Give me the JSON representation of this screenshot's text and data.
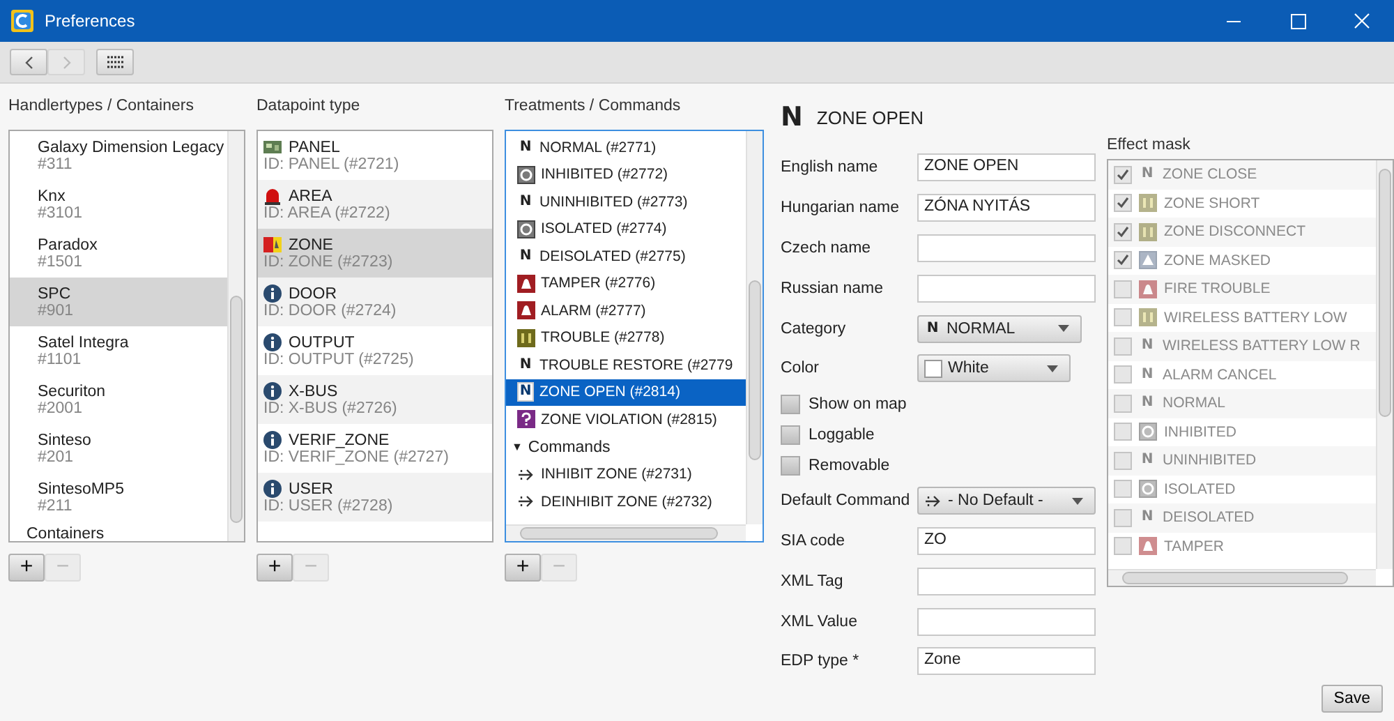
{
  "window": {
    "title": "Preferences"
  },
  "toolbar": {
    "back": {
      "disabled": false
    },
    "forward": {
      "disabled": true
    }
  },
  "handlers": {
    "heading": "Handlertypes / Containers",
    "items": [
      {
        "kind": "item",
        "name": "Galaxy Dimension Legacy",
        "id": "#311",
        "selected": false
      },
      {
        "kind": "item",
        "name": "Knx",
        "id": "#3101",
        "selected": false
      },
      {
        "kind": "item",
        "name": "Paradox",
        "id": "#1501",
        "selected": false
      },
      {
        "kind": "item",
        "name": "SPC",
        "id": "#901",
        "selected": true
      },
      {
        "kind": "item",
        "name": "Satel Integra",
        "id": "#1101",
        "selected": false
      },
      {
        "kind": "item",
        "name": "Securiton",
        "id": "#2001",
        "selected": false
      },
      {
        "kind": "item",
        "name": "Sinteso",
        "id": "#201",
        "selected": false
      },
      {
        "kind": "item",
        "name": "SintesoMP5",
        "id": "#211",
        "selected": false
      },
      {
        "kind": "group",
        "name": "Containers"
      }
    ],
    "add": {
      "label": "+",
      "disabled": false
    },
    "remove": {
      "label": "−",
      "disabled": true
    }
  },
  "datapoints": {
    "heading": "Datapoint type",
    "items": [
      {
        "kind": "panel",
        "name": "PANEL",
        "id": "ID: PANEL (#2721)",
        "selected": false
      },
      {
        "kind": "beacon",
        "name": "AREA",
        "id": "ID: AREA (#2722)",
        "selected": false
      },
      {
        "kind": "zone",
        "name": "ZONE",
        "id": "ID: ZONE (#2723)",
        "selected": true
      },
      {
        "kind": "info",
        "name": "DOOR",
        "id": "ID: DOOR (#2724)",
        "selected": false
      },
      {
        "kind": "info",
        "name": "OUTPUT",
        "id": "ID: OUTPUT (#2725)",
        "selected": false
      },
      {
        "kind": "info",
        "name": "X-BUS",
        "id": "ID: X-BUS (#2726)",
        "selected": false
      },
      {
        "kind": "info",
        "name": "VERIF_ZONE",
        "id": "ID: VERIF_ZONE (#2727)",
        "selected": false
      },
      {
        "kind": "info",
        "name": "USER",
        "id": "ID: USER (#2728)",
        "selected": false
      }
    ],
    "add": {
      "label": "+",
      "disabled": false
    },
    "remove": {
      "label": "−",
      "disabled": true
    }
  },
  "treatments": {
    "heading": "Treatments / Commands",
    "items": [
      {
        "kind": "letter",
        "glyph": "N",
        "label": "NORMAL (#2771)",
        "selected": false
      },
      {
        "kind": "inhibit",
        "label": "INHIBITED (#2772)",
        "selected": false
      },
      {
        "kind": "letter",
        "glyph": "N",
        "label": "UNINHIBITED (#2773)",
        "selected": false
      },
      {
        "kind": "inhibit",
        "label": "ISOLATED (#2774)",
        "selected": false
      },
      {
        "kind": "letter",
        "glyph": "N",
        "label": "DEISOLATED (#2775)",
        "selected": false
      },
      {
        "kind": "bell",
        "label": "TAMPER (#2776)",
        "selected": false
      },
      {
        "kind": "bell",
        "label": "ALARM (#2777)",
        "selected": false
      },
      {
        "kind": "trouble",
        "label": "TROUBLE (#2778)",
        "selected": false
      },
      {
        "kind": "letter",
        "glyph": "N",
        "label": "TROUBLE RESTORE (#2779",
        "selected": false
      },
      {
        "kind": "letter",
        "glyph": "N",
        "label": "ZONE OPEN (#2814)",
        "selected": true
      },
      {
        "kind": "question",
        "label": "ZONE VIOLATION (#2815)",
        "selected": false
      }
    ],
    "groups": [
      {
        "toggle": "▼",
        "label": "Commands",
        "expanded": true,
        "children": [
          {
            "kind": "command",
            "label": "INHIBIT ZONE (#2731)",
            "selected": false
          },
          {
            "kind": "command",
            "label": "DEINHIBIT ZONE (#2732)",
            "selected": false
          }
        ]
      }
    ],
    "add": {
      "label": "+",
      "disabled": false
    },
    "remove": {
      "label": "−",
      "disabled": true
    }
  },
  "detail": {
    "glyph": "N",
    "title": "ZONE OPEN",
    "fields": [
      {
        "kind": "text",
        "label": "English name",
        "value": "ZONE OPEN"
      },
      {
        "kind": "text",
        "label": "Hungarian name",
        "value": "ZÓNA NYITÁS"
      },
      {
        "kind": "text",
        "label": "Czech name"
      },
      {
        "kind": "text",
        "label": "Russian name"
      },
      {
        "kind": "select",
        "label": "Category",
        "glyph": "N",
        "value": "NORMAL"
      },
      {
        "kind": "select",
        "label": "Color",
        "color": "#ffffff",
        "value": "White"
      },
      {
        "kind": "checkbox",
        "label": "Show on map",
        "checked": false
      },
      {
        "kind": "checkbox",
        "label": "Loggable",
        "checked": false
      },
      {
        "kind": "checkbox",
        "label": "Removable",
        "checked": false
      },
      {
        "kind": "select",
        "label": "Default Command",
        "value": "- No Default -"
      },
      {
        "kind": "text",
        "label": "SIA code",
        "value": "ZO"
      },
      {
        "kind": "text",
        "label": "XML Tag"
      },
      {
        "kind": "text",
        "label": "XML Value"
      },
      {
        "kind": "text",
        "label": "EDP type *",
        "value": "Zone"
      }
    ]
  },
  "mask": {
    "heading": "Effect mask",
    "disabled": true,
    "items": [
      {
        "kind": "letter",
        "glyph": "N",
        "label": "ZONE CLOSE",
        "checked": true
      },
      {
        "kind": "trouble",
        "label": "ZONE SHORT",
        "checked": true
      },
      {
        "kind": "trouble",
        "label": "ZONE DISCONNECT",
        "checked": true
      },
      {
        "kind": "masked",
        "label": "ZONE MASKED",
        "checked": true
      },
      {
        "kind": "bell",
        "label": "FIRE TROUBLE",
        "checked": false
      },
      {
        "kind": "trouble",
        "label": "WIRELESS BATTERY LOW",
        "checked": false
      },
      {
        "kind": "letter",
        "glyph": "N",
        "label": "WIRELESS BATTERY LOW R",
        "checked": false
      },
      {
        "kind": "letter",
        "glyph": "N",
        "label": "ALARM CANCEL",
        "checked": false
      },
      {
        "kind": "letter",
        "glyph": "N",
        "label": "NORMAL",
        "checked": false
      },
      {
        "kind": "inhibit",
        "label": "INHIBITED",
        "checked": false
      },
      {
        "kind": "letter",
        "glyph": "N",
        "label": "UNINHIBITED",
        "checked": false
      },
      {
        "kind": "inhibit",
        "label": "ISOLATED",
        "checked": false
      },
      {
        "kind": "letter",
        "glyph": "N",
        "label": "DEISOLATED",
        "checked": false
      },
      {
        "kind": "bell",
        "label": "TAMPER",
        "checked": false
      }
    ]
  },
  "save": "Save"
}
